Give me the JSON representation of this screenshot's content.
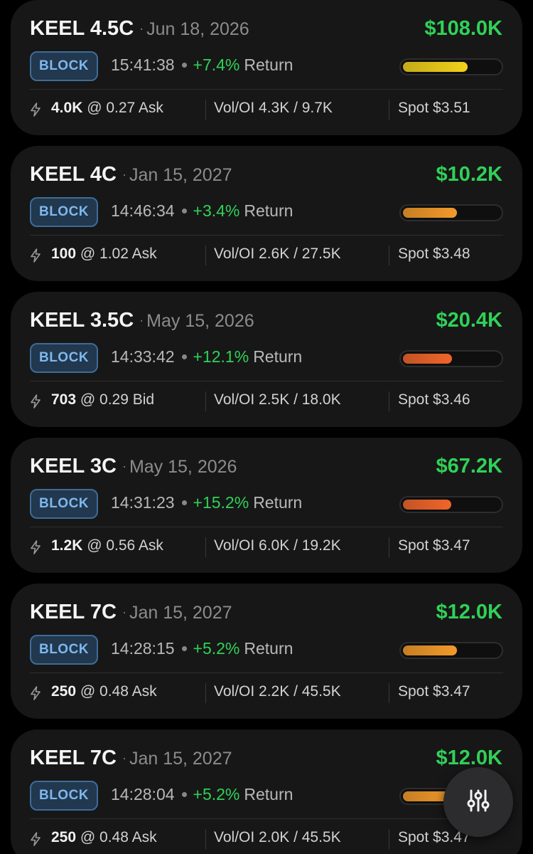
{
  "colors": {
    "accent_green": "#30d158",
    "badge_text": "#7eb8ee",
    "bar_yellow": "#f2d21a",
    "bar_orange": "#f39a2a",
    "bar_deep_orange": "#f0652a"
  },
  "fab": {
    "icon": "sliders-filter-icon"
  },
  "cards": [
    {
      "ticker": "KEEL 4.5C",
      "expiry": "Jun 18, 2026",
      "premium": "$108.0K",
      "badge": "BLOCK",
      "time": "15:41:38",
      "return_value": "+7.4%",
      "return_label": "Return",
      "bar_level": 0.66,
      "bar_color": "#f2d21a",
      "trade_size": "4.0K",
      "trade_rest": "@ 0.27 Ask",
      "vol_oi": "Vol/OI 4.3K / 9.7K",
      "spot": "Spot $3.51"
    },
    {
      "ticker": "KEEL 4C",
      "expiry": "Jan 15, 2027",
      "premium": "$10.2K",
      "badge": "BLOCK",
      "time": "14:46:34",
      "return_value": "+3.4%",
      "return_label": "Return",
      "bar_level": 0.55,
      "bar_color": "#f39a2a",
      "trade_size": "100",
      "trade_rest": "@ 1.02 Ask",
      "vol_oi": "Vol/OI 2.6K / 27.5K",
      "spot": "Spot $3.48"
    },
    {
      "ticker": "KEEL 3.5C",
      "expiry": "May 15, 2026",
      "premium": "$20.4K",
      "badge": "BLOCK",
      "time": "14:33:42",
      "return_value": "+12.1%",
      "return_label": "Return",
      "bar_level": 0.5,
      "bar_color": "#f0652a",
      "trade_size": "703",
      "trade_rest": "@ 0.29 Bid",
      "vol_oi": "Vol/OI 2.5K / 18.0K",
      "spot": "Spot $3.46"
    },
    {
      "ticker": "KEEL 3C",
      "expiry": "May 15, 2026",
      "premium": "$67.2K",
      "badge": "BLOCK",
      "time": "14:31:23",
      "return_value": "+15.2%",
      "return_label": "Return",
      "bar_level": 0.49,
      "bar_color": "#f0652a",
      "trade_size": "1.2K",
      "trade_rest": "@ 0.56 Ask",
      "vol_oi": "Vol/OI 6.0K / 19.2K",
      "spot": "Spot $3.47"
    },
    {
      "ticker": "KEEL 7C",
      "expiry": "Jan 15, 2027",
      "premium": "$12.0K",
      "badge": "BLOCK",
      "time": "14:28:15",
      "return_value": "+5.2%",
      "return_label": "Return",
      "bar_level": 0.55,
      "bar_color": "#f39a2a",
      "trade_size": "250",
      "trade_rest": "@ 0.48 Ask",
      "vol_oi": "Vol/OI 2.2K / 45.5K",
      "spot": "Spot $3.47"
    },
    {
      "ticker": "KEEL 7C",
      "expiry": "Jan 15, 2027",
      "premium": "$12.0K",
      "badge": "BLOCK",
      "time": "14:28:04",
      "return_value": "+5.2%",
      "return_label": "Return",
      "bar_level": 0.55,
      "bar_color": "#f39a2a",
      "trade_size": "250",
      "trade_rest": "@ 0.48 Ask",
      "vol_oi": "Vol/OI 2.0K / 45.5K",
      "spot": "Spot $3.47"
    }
  ]
}
